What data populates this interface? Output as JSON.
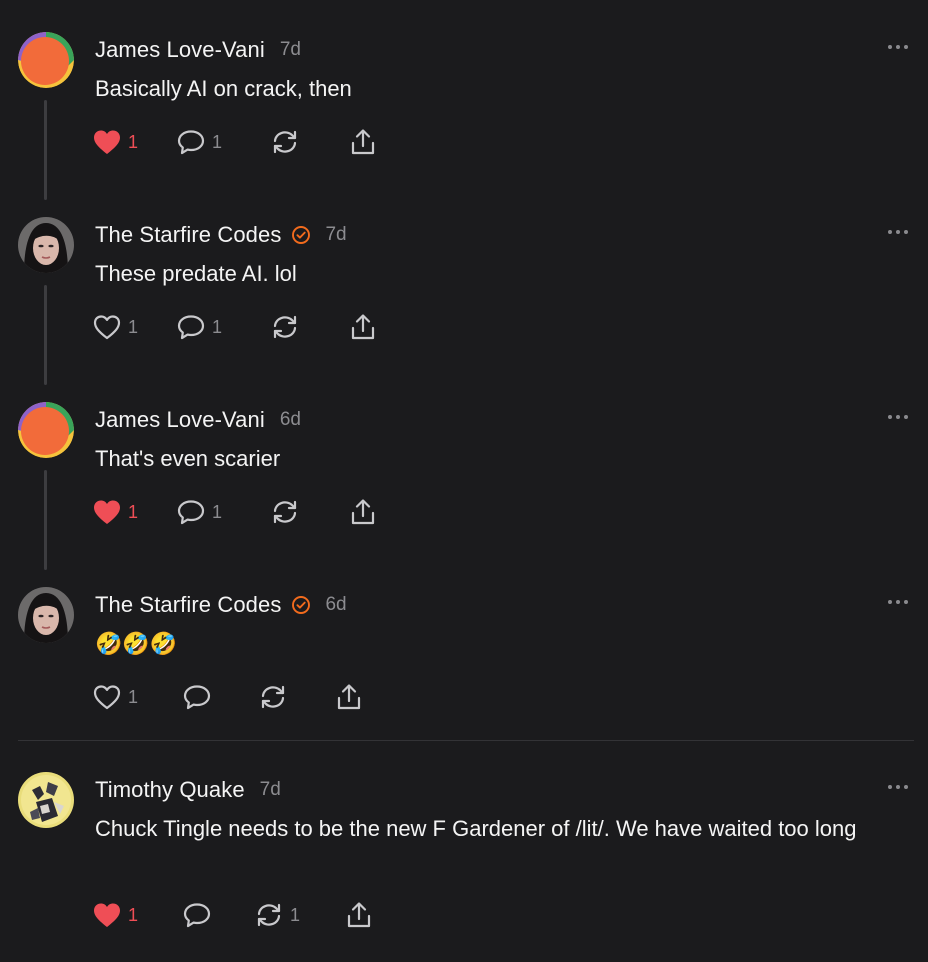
{
  "colors": {
    "background": "#1b1b1d",
    "like_active": "#ef4e56",
    "verified": "#f26b1d",
    "muted": "#8c8c90"
  },
  "posts": [
    {
      "author": "James Love-Vani",
      "time": "7d",
      "verified": false,
      "text": "Basically AI on crack, then",
      "liked": true,
      "likes": "1",
      "comments": "1",
      "restacks": "",
      "avatar": "orange-circle-avatar"
    },
    {
      "author": "The Starfire Codes",
      "time": "7d",
      "verified": true,
      "text": "These predate AI. lol",
      "liked": false,
      "likes": "1",
      "comments": "1",
      "restacks": "",
      "avatar": "photo-avatar-woman"
    },
    {
      "author": "James Love-Vani",
      "time": "6d",
      "verified": false,
      "text": "That's even scarier",
      "liked": true,
      "likes": "1",
      "comments": "1",
      "restacks": "",
      "avatar": "orange-circle-avatar"
    },
    {
      "author": "The Starfire Codes",
      "time": "6d",
      "verified": true,
      "text": "🤣🤣🤣",
      "liked": false,
      "likes": "1",
      "comments": "",
      "restacks": "",
      "avatar": "photo-avatar-woman"
    },
    {
      "author": "Timothy Quake",
      "time": "7d",
      "verified": false,
      "text": "Chuck Tingle needs to be the new F Gardener of /lit/. We have waited too long",
      "liked": true,
      "likes": "1",
      "comments": "",
      "restacks": "1",
      "avatar": "illustration-avatar"
    }
  ],
  "icons": {
    "like": "heart-icon",
    "comment": "comment-bubble-icon",
    "restack": "restack-icon",
    "share": "share-icon",
    "more": "more-options-icon",
    "verified": "verified-check-icon"
  }
}
